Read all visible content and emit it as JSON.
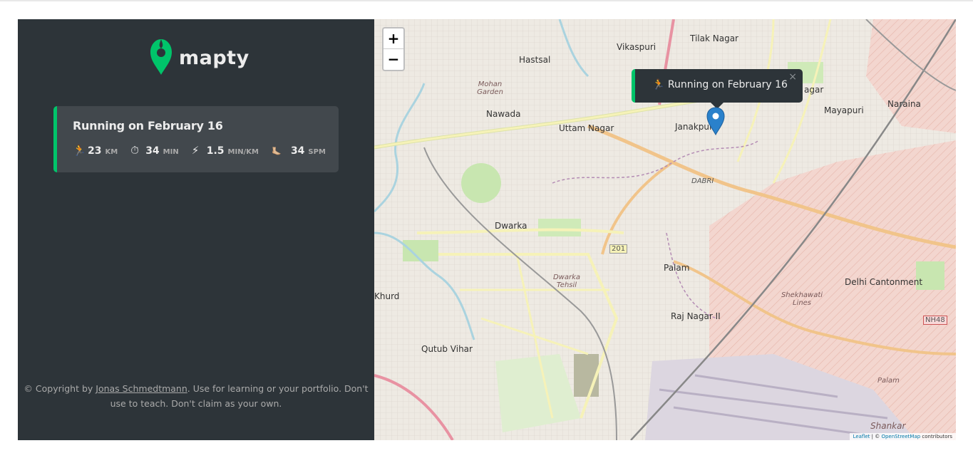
{
  "app": {
    "name": "mapty"
  },
  "workout": {
    "title": "Running on February 16",
    "details": [
      {
        "icon": "🏃",
        "icon_name": "running-icon",
        "value": "23",
        "unit": "KM"
      },
      {
        "icon": "⏱",
        "icon_name": "stopwatch-icon",
        "value": "34",
        "unit": "MIN"
      },
      {
        "icon": "⚡",
        "icon_name": "lightning-icon",
        "value": "1.5",
        "unit": "MIN/KM"
      },
      {
        "icon": "🦶🏼",
        "icon_name": "footprint-icon",
        "value": "34",
        "unit": "SPM"
      }
    ]
  },
  "copyright": {
    "prefix": "© Copyright by ",
    "author": "Jonas Schmedtmann",
    "suffix": ". Use for learning or your portfolio. Don't use to teach. Don't claim as your own."
  },
  "map": {
    "zoom_in": "+",
    "zoom_out": "−",
    "popup": {
      "text": "🏃 Running on February 16",
      "close": "×"
    },
    "attribution": {
      "leaflet": "Leaflet",
      "sep": " | © ",
      "osm": "OpenStreetMap",
      "contributors": " contributors"
    },
    "labels": {
      "hastsal": "Hastsal",
      "vikaspuri": "Vikaspuri",
      "tilak_nagar": "Tilak Nagar",
      "nawada": "Nawada",
      "uttam_nagar": "Uttam Nagar",
      "janakpuri": "Janakpuri",
      "mayapuri": "Mayapuri",
      "naraina": "Naraina",
      "dwarka": "Dwarka",
      "palam": "Palam",
      "delhi_cantonment": "Delhi Cantonment",
      "raj_nagar": "Raj Nagar II",
      "khurd": "Khurd",
      "qutub_vihar": "Qutub Vihar",
      "dwarka_tehsil": "Dwarka Tehsil",
      "shekhawati": "Shekhawati Lines",
      "dabri": "DABRI",
      "mohan_garden": "Mohan Garden",
      "shankar": "Shankar",
      "nh48": "NH48",
      "r201": "201",
      "palam2": "Palam",
      "nagar": "agar"
    },
    "colors": {
      "accent": "#00c46a",
      "sidebar": "#2d3439",
      "marker": "#2a81cb"
    }
  }
}
